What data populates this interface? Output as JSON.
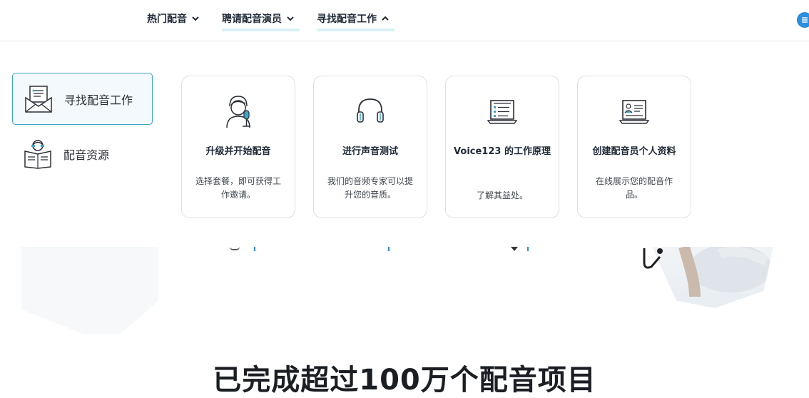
{
  "nav": {
    "items": [
      {
        "label": "热门配音"
      },
      {
        "label": "聘请配音演员"
      },
      {
        "label": "寻找配音工作"
      }
    ]
  },
  "sidebar": {
    "items": [
      {
        "label": "寻找配音工作",
        "icon": "envelope-letter-icon",
        "active": true
      },
      {
        "label": "配音资源",
        "icon": "reader-book-icon",
        "active": false
      }
    ]
  },
  "cards": [
    {
      "icon": "voice-actor-mic-icon",
      "title": "升级并开始配音",
      "desc": "选择套餐，即可获得工作邀请。"
    },
    {
      "icon": "headphones-icon",
      "title": "进行声音测试",
      "desc": "我们的音频专家可以提升您的音质。"
    },
    {
      "icon": "laptop-list-icon",
      "title": "Voice123 的工作原理",
      "desc": "了解其益处。"
    },
    {
      "icon": "laptop-profile-icon",
      "title": "创建配音员个人资料",
      "desc": "在线展示您的配音作品。"
    }
  ],
  "headline": "已完成超过100万个配音项目",
  "colors": {
    "accent": "#3aa6c9",
    "underline": "#d7f1f6",
    "menu_button": "#2b8ede"
  }
}
